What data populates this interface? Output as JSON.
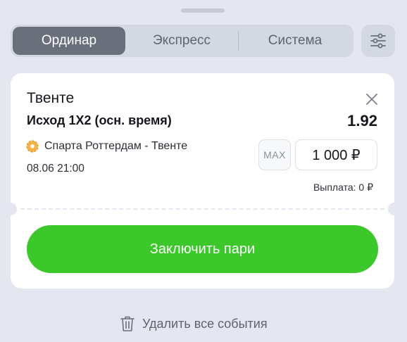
{
  "tabs": [
    {
      "label": "Ординар",
      "active": true
    },
    {
      "label": "Экспресс",
      "active": false
    },
    {
      "label": "Система",
      "active": false
    }
  ],
  "settings": {
    "icon": "sliders-icon"
  },
  "bet": {
    "team": "Твенте",
    "market": "Исход 1X2 (осн. время)",
    "odds": "1.92",
    "match": "Спарта Роттердам - Твенте",
    "sport_icon": "football-icon",
    "datetime": "08.06 21:00",
    "max_label": "MAX",
    "amount": "1 000 ₽",
    "payout": "Выплата: 0 ₽"
  },
  "place_bet_label": "Заключить пари",
  "delete_all_label": "Удалить все события",
  "colors": {
    "accent_green": "#3cc72a",
    "active_tab": "#6a6f7c",
    "background": "#e4e7ef"
  }
}
